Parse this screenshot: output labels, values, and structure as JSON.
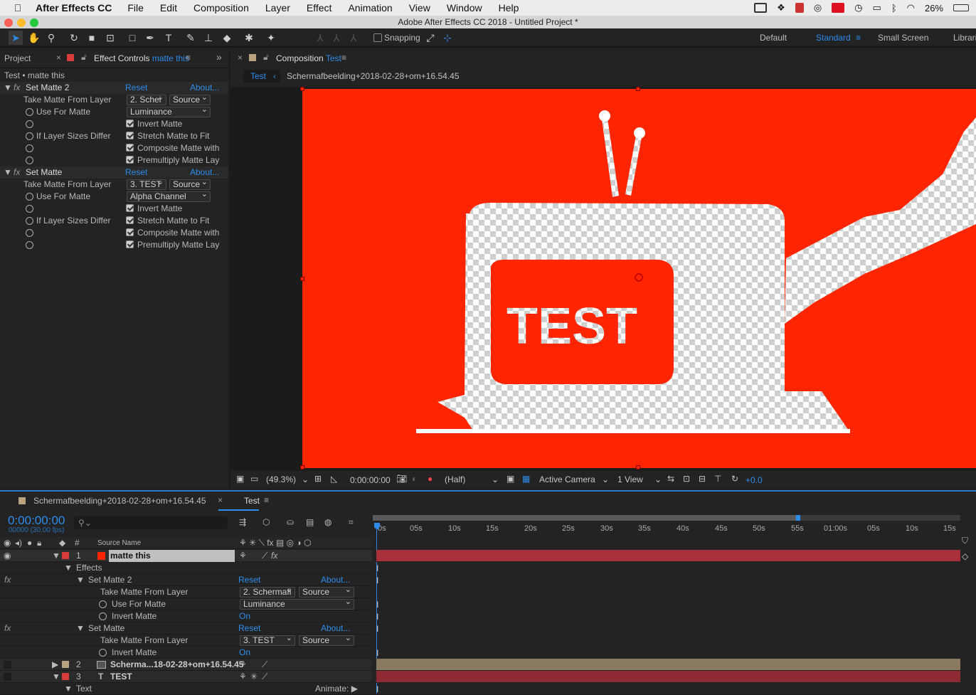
{
  "menubar": {
    "app_name": "After Effects CC",
    "items": [
      "File",
      "Edit",
      "Composition",
      "Layer",
      "Effect",
      "Animation",
      "View",
      "Window",
      "Help"
    ],
    "battery": "26%"
  },
  "window_title": "Adobe After Effects CC 2018 - Untitled Project *",
  "toolbar": {
    "snapping_label": "Snapping",
    "workspaces": [
      "Default",
      "Standard",
      "Small Screen",
      "Librari"
    ]
  },
  "left_panel": {
    "tab_project": "Project",
    "tab_effect_controls_prefix": "Effect Controls",
    "tab_effect_controls_layer": "matte this",
    "breadcrumb": "Test • matte this",
    "effects": [
      {
        "name": "Set Matte 2",
        "reset": "Reset",
        "about": "About...",
        "take_matte_label": "Take Matte From Layer",
        "take_matte_value": "2. Schei",
        "take_matte_source": "Source",
        "use_for_matte_label": "Use For Matte",
        "use_for_matte_value": "Luminance",
        "invert": "Invert Matte",
        "sizes_label": "If Layer Sizes Differ",
        "stretch": "Stretch Matte to Fit",
        "composite": "Composite Matte with",
        "premultiply": "Premultiply Matte Lay"
      },
      {
        "name": "Set Matte",
        "reset": "Reset",
        "about": "About...",
        "take_matte_label": "Take Matte From Layer",
        "take_matte_value": "3. TEST",
        "take_matte_source": "Source",
        "use_for_matte_label": "Use For Matte",
        "use_for_matte_value": "Alpha Channel",
        "invert": "Invert Matte",
        "sizes_label": "If Layer Sizes Differ",
        "stretch": "Stretch Matte to Fit",
        "composite": "Composite Matte with",
        "premultiply": "Premultiply Matte Lay"
      }
    ]
  },
  "comp_panel": {
    "tab_prefix": "Composition",
    "tab_name": "Test",
    "crumb_active": "Test",
    "crumb_layer": "Schermafbeelding+2018-02-28+om+16.54.45",
    "canvas_text": "TEST",
    "footer": {
      "zoom": "(49.3%)",
      "timecode": "0:00:00:00",
      "resolution": "(Half)",
      "camera": "Active Camera",
      "views": "1 View",
      "exposure": "+0.0"
    }
  },
  "timeline": {
    "tab_inactive": "Schermafbeelding+2018-02-28+om+16.54.45",
    "tab_active": "Test",
    "timecode": "0:00:00:00",
    "frames": "00000 (30.00 fps)",
    "col_hash": "#",
    "col_source": "Source Name",
    "ruler": [
      "0s",
      "05s",
      "10s",
      "15s",
      "20s",
      "25s",
      "30s",
      "35s",
      "40s",
      "45s",
      "50s",
      "55s",
      "01:00s",
      "05s",
      "10s",
      "15s"
    ],
    "layer1": {
      "num": "1",
      "name": "matte this"
    },
    "effects_label": "Effects",
    "setmatte2": {
      "name": "Set Matte 2",
      "reset": "Reset",
      "about": "About...",
      "take": "Take Matte From Layer",
      "take_val": "2. Schermafl",
      "take_src": "Source",
      "use": "Use For Matte",
      "use_val": "Luminance",
      "invert": "Invert Matte",
      "invert_val": "On"
    },
    "setmatte": {
      "name": "Set Matte",
      "reset": "Reset",
      "about": "About...",
      "take": "Take Matte From Layer",
      "take_val": "3. TEST",
      "take_src": "Source",
      "invert": "Invert Matte",
      "invert_val": "On"
    },
    "layer2": {
      "num": "2",
      "name": "Scherma...18-02-28+om+16.54.45"
    },
    "layer3": {
      "num": "3",
      "name": "TEST"
    },
    "text_group": "Text",
    "animate": "Animate:"
  },
  "colors": {
    "accent": "#2d8ceb",
    "comp_red": "#ff2500",
    "label_red": "#d93a3a",
    "label_tan": "#b9a27f"
  }
}
